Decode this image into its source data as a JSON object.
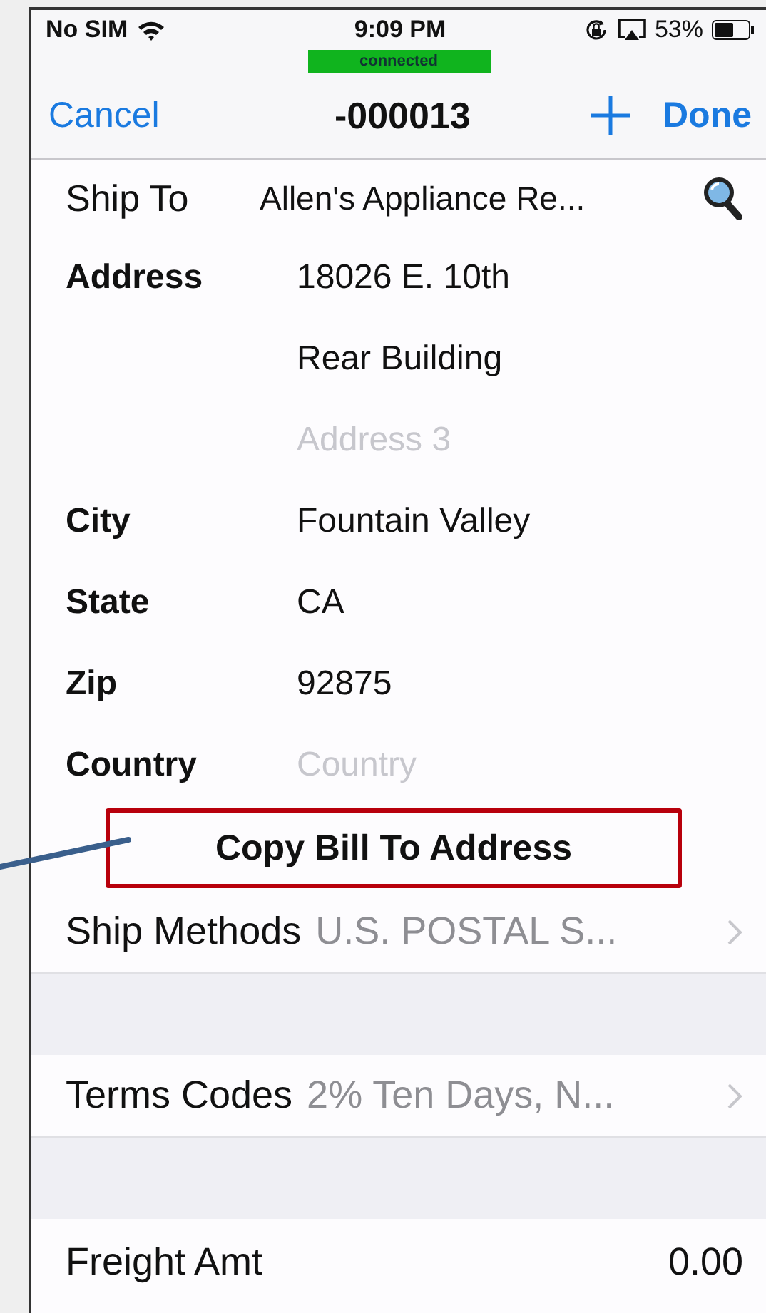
{
  "status_bar": {
    "carrier": "No SIM",
    "time": "9:09 PM",
    "battery": "53%",
    "connection": "connected"
  },
  "nav": {
    "cancel": "Cancel",
    "title": "-000013",
    "done": "Done"
  },
  "form": [
    {
      "kind": "lookup",
      "label": "Ship To",
      "value": "Allen's Appliance Re..."
    },
    {
      "kind": "field",
      "label": "Address",
      "value": "18026 E. 10th"
    },
    {
      "kind": "field",
      "value": "Rear Building"
    },
    {
      "kind": "field",
      "placeholder": "Address 3"
    },
    {
      "kind": "field",
      "label": "City",
      "value": "Fountain Valley"
    },
    {
      "kind": "field",
      "label": "State",
      "value": "CA"
    },
    {
      "kind": "field",
      "label": "Zip",
      "value": "92875"
    },
    {
      "kind": "field",
      "label": "Country",
      "placeholder": "Country"
    },
    {
      "kind": "button",
      "label": "Copy Bill To Address",
      "highlighted": true
    },
    {
      "kind": "picker",
      "label": "Ship Methods",
      "value": "U.S. POSTAL S..."
    },
    {
      "kind": "spacer"
    },
    {
      "kind": "picker",
      "label": "Terms Codes",
      "value": "2% Ten Days, N..."
    },
    {
      "kind": "spacer"
    },
    {
      "kind": "amount",
      "label": "Freight Amt",
      "value": "0.00"
    }
  ]
}
